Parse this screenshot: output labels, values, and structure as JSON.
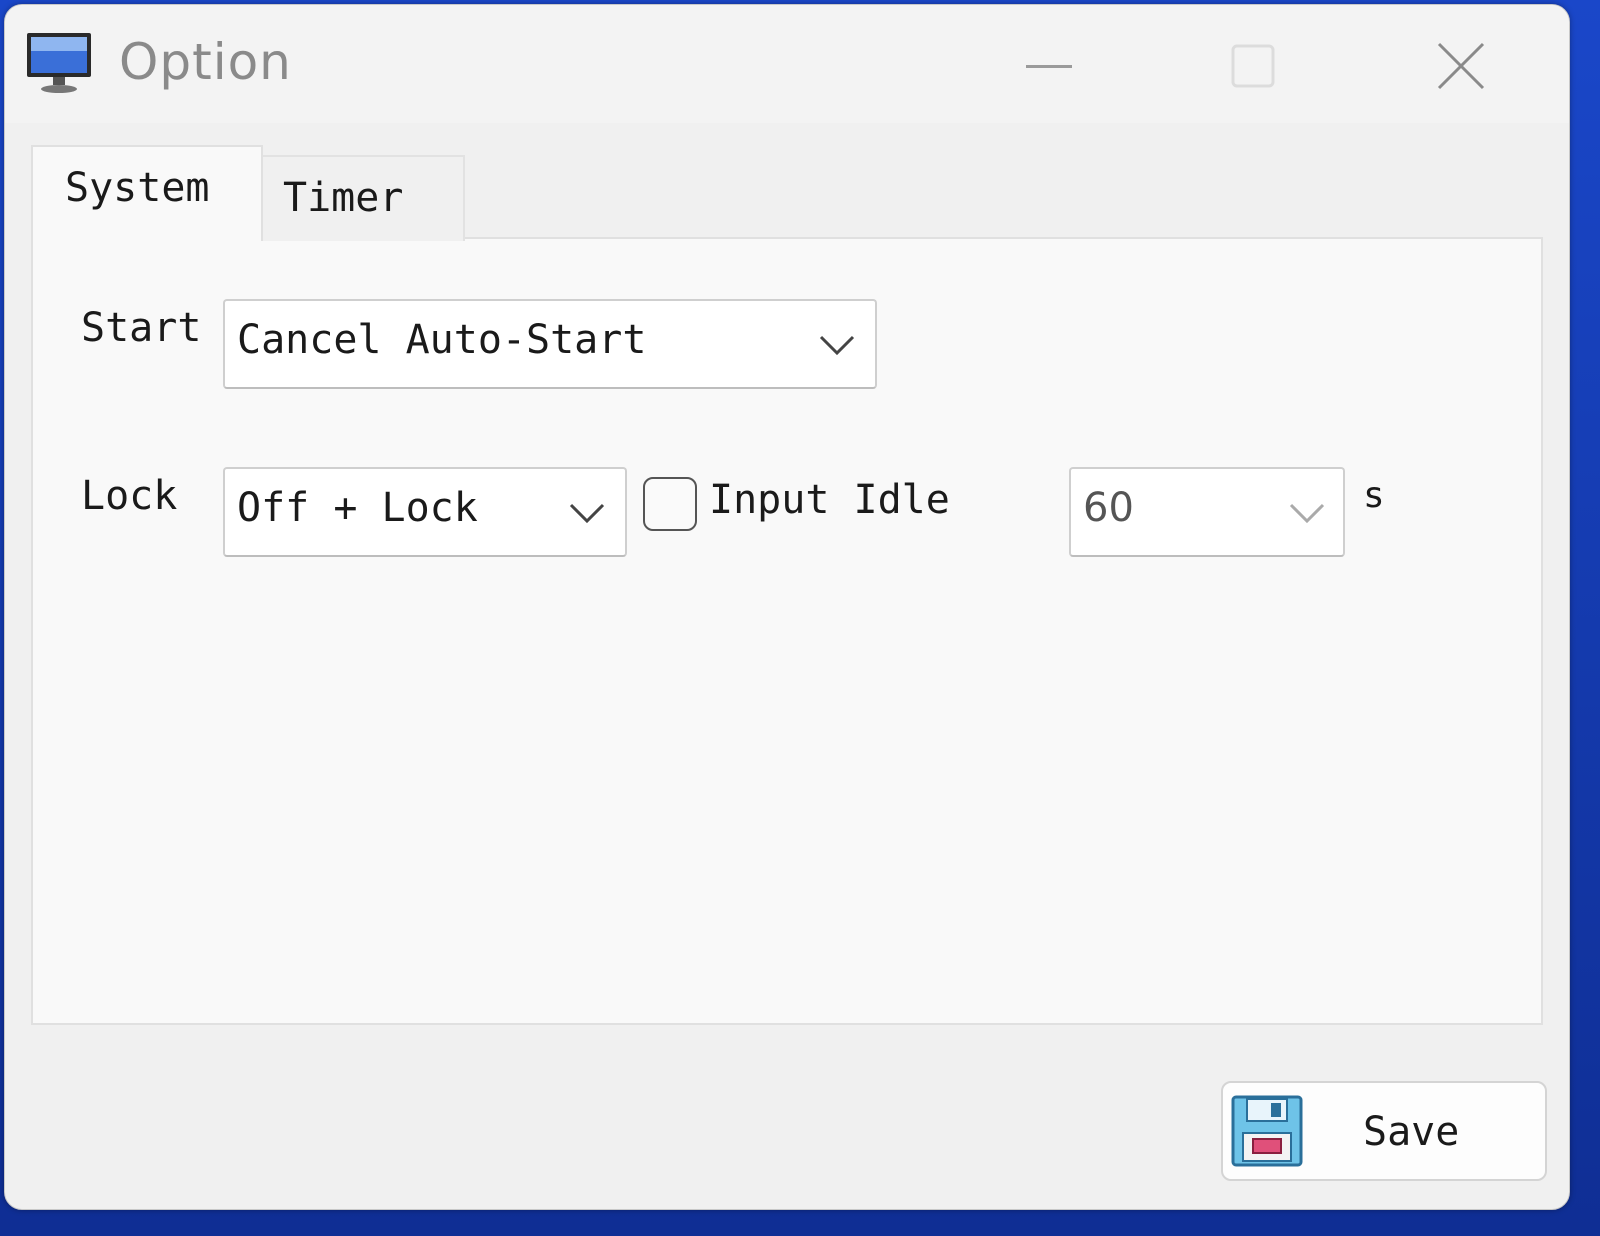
{
  "window": {
    "title": "Option"
  },
  "titlebar": {
    "minimize_label": "Minimize",
    "maximize_label": "Maximize",
    "close_label": "Close"
  },
  "tabs": [
    {
      "label": "System",
      "selected": true
    },
    {
      "label": "Timer",
      "selected": false
    }
  ],
  "system": {
    "start_label": "Start",
    "start_value": "Cancel Auto-Start",
    "lock_label": "Lock",
    "lock_value": "Off + Lock",
    "input_idle_label": "Input Idle",
    "input_idle_checked": false,
    "idle_value": "60",
    "idle_unit": "s"
  },
  "footer": {
    "save_label": "Save"
  },
  "icons": {
    "app": "monitor-icon",
    "save": "floppy-disk-icon",
    "dropdown": "chevron-down-icon"
  },
  "colors": {
    "window_bg": "#f0f0f0",
    "panel_bg": "#f9f9f9",
    "title_text": "#8a8a8a",
    "desktop": "#1a47c9"
  }
}
